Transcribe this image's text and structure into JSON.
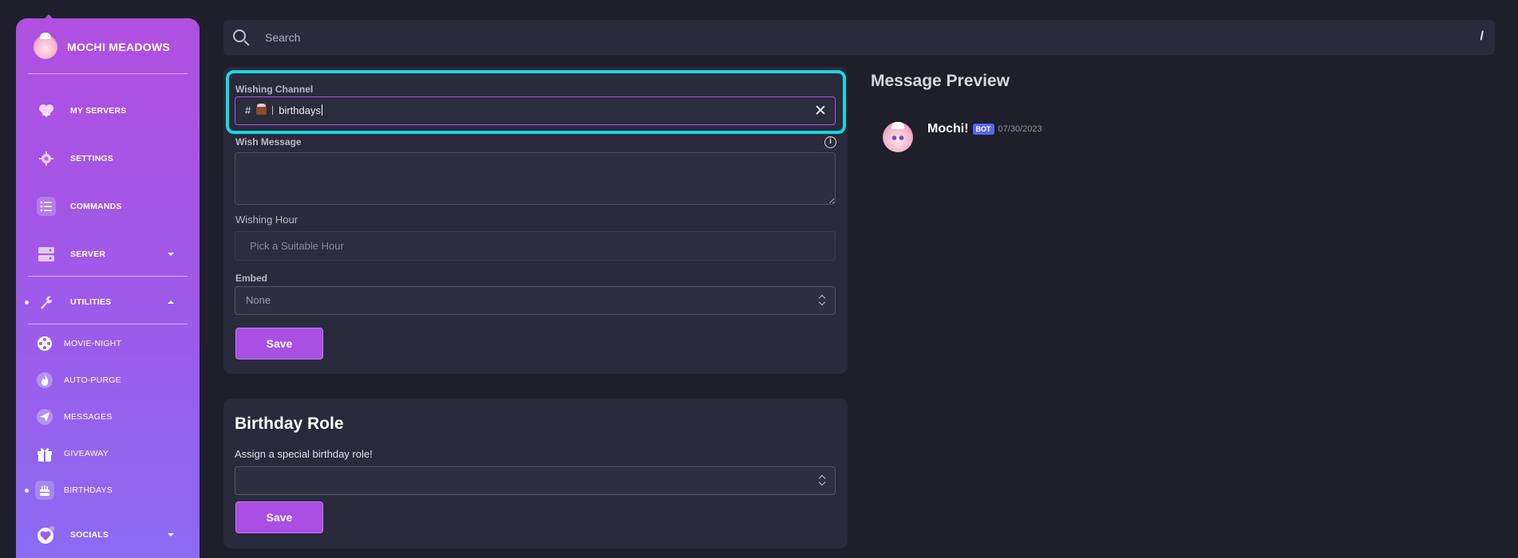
{
  "sidebar": {
    "brand": "MOCHI MEADOWS",
    "items": [
      {
        "label": "MY SERVERS",
        "icon": "heart-icon"
      },
      {
        "label": "SETTINGS",
        "icon": "gear-icon"
      },
      {
        "label": "COMMANDS",
        "icon": "list-icon"
      },
      {
        "label": "SERVER",
        "icon": "server-icon"
      },
      {
        "label": "UTILITIES",
        "icon": "wrench-icon"
      },
      {
        "label": "MOVIE-NIGHT",
        "icon": "film-reel-icon"
      },
      {
        "label": "AUTO-PURGE",
        "icon": "flame-icon"
      },
      {
        "label": "MESSAGES",
        "icon": "paper-plane-icon"
      },
      {
        "label": "GIVEAWAY",
        "icon": "gift-icon"
      },
      {
        "label": "BIRTHDAYS",
        "icon": "cake-icon"
      },
      {
        "label": "SOCIALS",
        "icon": "heart-badge-icon"
      }
    ]
  },
  "search": {
    "placeholder": "Search",
    "shortcut": "/"
  },
  "wish_settings": {
    "channel_label": "Wishing Channel",
    "channel_hash": "#",
    "channel_name": "birthdays",
    "message_label": "Wish Message",
    "message_value": "",
    "hour_label": "Wishing Hour",
    "hour_placeholder": "Pick a Suitable Hour",
    "embed_label": "Embed",
    "embed_value": "None",
    "save_label": "Save"
  },
  "birthday_role": {
    "title": "Birthday Role",
    "subtitle": "Assign a special birthday role!",
    "role_value": "",
    "save_label": "Save"
  },
  "preview": {
    "title": "Message Preview",
    "author": "Mochi!",
    "badge": "BOT",
    "timestamp": "07/30/2023"
  },
  "colors": {
    "accent": "#a94fe2",
    "highlight": "#1ad7e0",
    "background": "#1e1f2b",
    "card": "#292a3b",
    "bot_badge": "#5865f2"
  }
}
